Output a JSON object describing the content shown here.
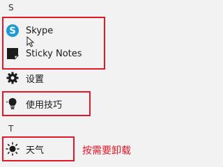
{
  "groups": [
    {
      "letter": "S"
    },
    {
      "letter": "T"
    }
  ],
  "apps": {
    "skype": {
      "label": "Skype",
      "icon": "skype-icon"
    },
    "sticky_notes": {
      "label": "Sticky Notes",
      "icon": "sticky-notes-icon"
    },
    "settings": {
      "label": "设置",
      "icon": "gear-icon"
    },
    "tips": {
      "label": "使用技巧",
      "icon": "lightbulb-icon"
    },
    "weather": {
      "label": "天气",
      "icon": "sun-icon"
    }
  },
  "annotation": {
    "text": "按需要卸载",
    "color": "#e0192a"
  },
  "colors": {
    "highlight": "#e0192a",
    "skype_brand": "#1a9bd7"
  }
}
